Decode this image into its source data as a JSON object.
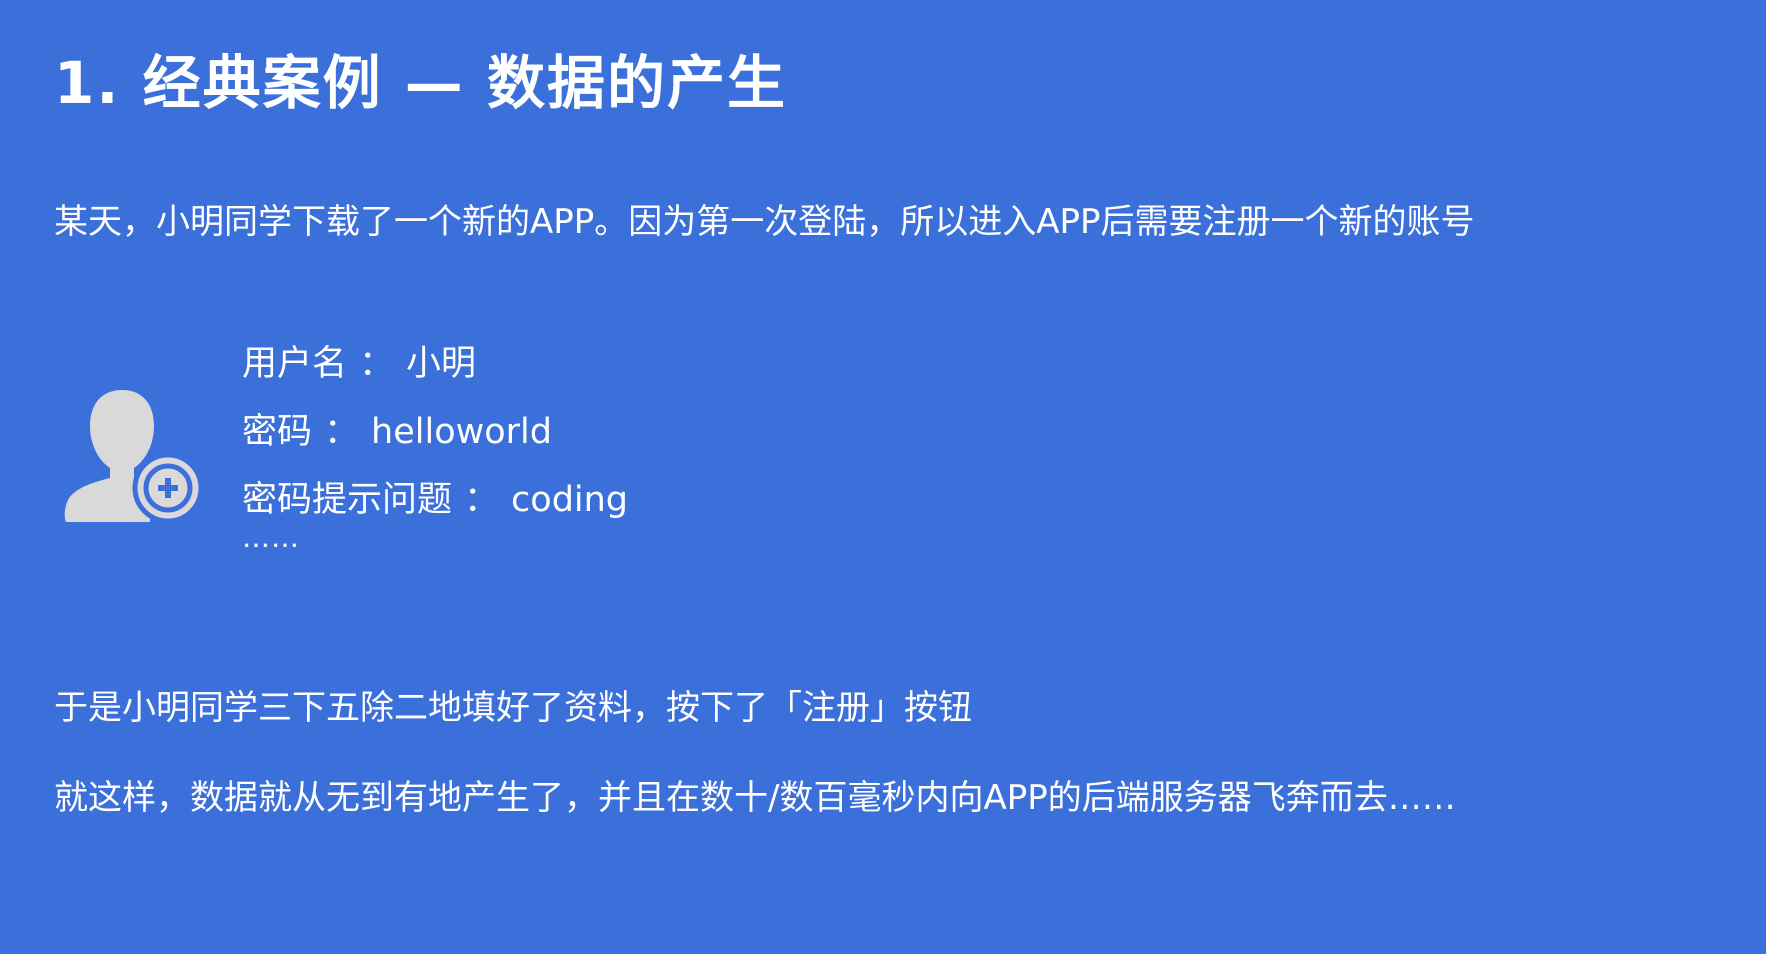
{
  "slide": {
    "title": "1. 经典案例 — 数据的产生",
    "intro": "某天，小明同学下载了一个新的APP。因为第一次登陆，所以进入APP后需要注册一个新的账号",
    "form": {
      "username_label": "用户名",
      "username_value": "小明",
      "password_label": "密码",
      "password_value": "helloworld",
      "hint_label": "密码提示问题",
      "hint_value": "coding",
      "separator": "：",
      "more": "……"
    },
    "paragraph_1": "于是小明同学三下五除二地填好了资料，按下了「注册」按钮",
    "paragraph_2": "就这样，数据就从无到有地产生了，并且在数十/数百毫秒内向APP的后端服务器飞奔而去……"
  },
  "icons": {
    "avatar": "add-user-icon"
  },
  "colors": {
    "background": "#3b6fd9",
    "text": "#ffffff",
    "icon_fill": "#d9d9d9"
  }
}
